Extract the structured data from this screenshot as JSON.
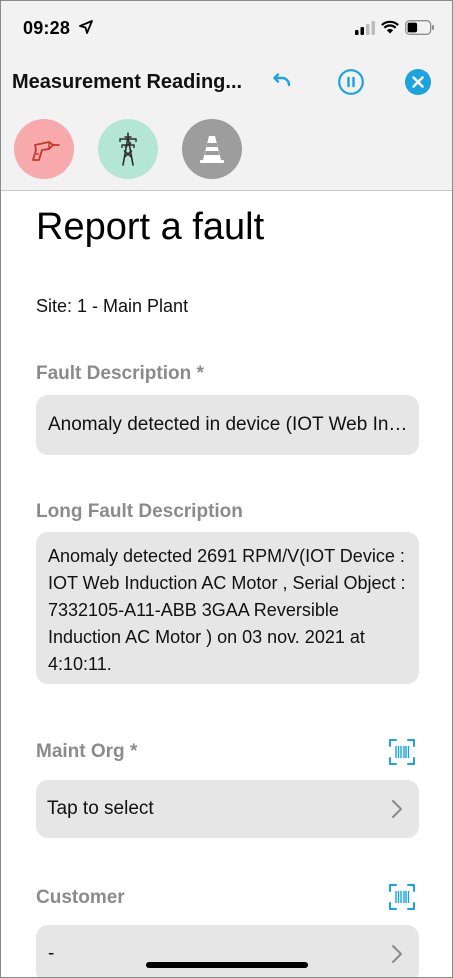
{
  "status_bar": {
    "time": "09:28",
    "icons": [
      "location-arrow-icon",
      "signal-icon",
      "wifi-icon",
      "battery-icon"
    ]
  },
  "nav": {
    "title": "Measurement Reading...",
    "buttons": [
      "undo-icon",
      "pause-icon",
      "close-icon"
    ],
    "accent_color": "#1aa3e0"
  },
  "toolbar": {
    "items": [
      {
        "icon": "drill-icon",
        "color": "#f7a9ab"
      },
      {
        "icon": "power-tower-icon",
        "color": "#b4e6d5"
      },
      {
        "icon": "traffic-cone-icon",
        "color": "#9d9d9d"
      }
    ]
  },
  "form": {
    "title": "Report a fault",
    "site": "Site: 1 - Main Plant",
    "fault_description": {
      "label": "Fault Description *",
      "value": "Anomaly detected in device (IOT Web Induction AC Motor)"
    },
    "long_fault_description": {
      "label": "Long Fault Description",
      "value": "Anomaly detected 2691 RPM/V(IOT Device : IOT Web Induction AC Motor , Serial Object : 7332105-A11-ABB 3GAA Reversible Induction AC Motor ) on 03 nov. 2021 at 4:10:11."
    },
    "maint_org": {
      "label": "Maint Org *",
      "value": "Tap to select"
    },
    "customer": {
      "label": "Customer",
      "value": "-"
    }
  }
}
